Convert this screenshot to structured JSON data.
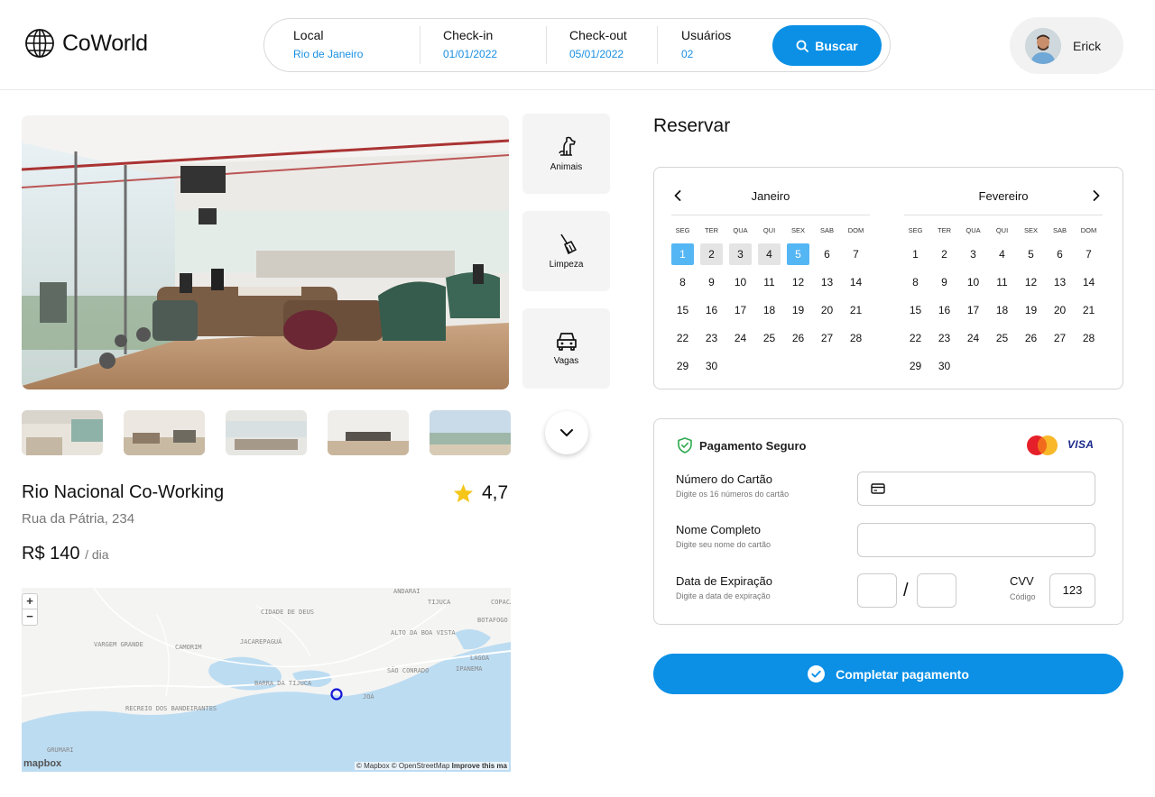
{
  "header": {
    "logo_text": "CoWorld",
    "search": {
      "fields": [
        {
          "label": "Local",
          "value": "Rio de Janeiro"
        },
        {
          "label": "Check-in",
          "value": "01/01/2022"
        },
        {
          "label": "Check-out",
          "value": "05/01/2022"
        },
        {
          "label": "Usuários",
          "value": "02"
        }
      ],
      "button_label": "Buscar"
    },
    "user": {
      "name": "Erick"
    }
  },
  "amenities": [
    {
      "label": "Animais",
      "icon": "dog-icon"
    },
    {
      "label": "Limpeza",
      "icon": "broom-icon"
    },
    {
      "label": "Vagas",
      "icon": "car-icon"
    }
  ],
  "place": {
    "name": "Rio Nacional Co-Working",
    "rating": "4,7",
    "address": "Rua da Pátria, 234",
    "price": "R$ 140",
    "price_unit": "/ dia"
  },
  "map": {
    "labels": [
      "ANDARAÍ",
      "CIDADE DE DEUS",
      "JACAREPAGUÁ",
      "ALTO DA BOA VISTA",
      "VARGEM GRANDE",
      "CAMORIM",
      "BARRA DA TIJUCA",
      "SÃO CONRADO",
      "BOTAFOGO",
      "IPANEMA",
      "RECREIO DOS BANDEIRANTES",
      "GRUMARI",
      "JOÁ",
      "TIJUCA",
      "COPACABANA",
      "LAGOA"
    ],
    "attribution": "© Mapbox © OpenStreetMap",
    "improve": "Improve this ma",
    "logo": "mapbox",
    "zoom_in": "+",
    "zoom_out": "−"
  },
  "reserve": {
    "title": "Reservar",
    "weekdays": [
      "SEG",
      "TER",
      "QUA",
      "QUI",
      "SEX",
      "SAB",
      "DOM"
    ],
    "months": [
      {
        "name": "Janeiro",
        "days": [
          "1",
          "2",
          "3",
          "4",
          "5",
          "6",
          "7",
          "8",
          "9",
          "10",
          "11",
          "12",
          "13",
          "14",
          "15",
          "16",
          "17",
          "18",
          "19",
          "20",
          "21",
          "22",
          "23",
          "24",
          "25",
          "26",
          "27",
          "28",
          "29",
          "30"
        ],
        "selected": [
          "1",
          "5"
        ],
        "in_range": [
          "2",
          "3",
          "4"
        ]
      },
      {
        "name": "Fevereiro",
        "days": [
          "1",
          "2",
          "3",
          "4",
          "5",
          "6",
          "7",
          "8",
          "9",
          "10",
          "11",
          "12",
          "13",
          "14",
          "15",
          "16",
          "17",
          "18",
          "19",
          "20",
          "21",
          "22",
          "23",
          "24",
          "25",
          "26",
          "27",
          "28",
          "29",
          "30"
        ],
        "selected": [],
        "in_range": []
      }
    ]
  },
  "payment": {
    "title": "Pagamento Seguro",
    "card_brand": "VISA",
    "card_number": {
      "label": "Número do Cartão",
      "hint": "Digite os 16 números do cartão"
    },
    "full_name": {
      "label": "Nome Completo",
      "hint": "Digite seu nome do cartão"
    },
    "expiry": {
      "label": "Data de Expiração",
      "hint": "Digite a data de expiração",
      "separator": "/"
    },
    "cvv": {
      "label": "CVV",
      "hint": "Código",
      "value": "123"
    },
    "submit_label": "Completar pagamento"
  },
  "colors": {
    "accent": "#0b90e6",
    "link": "#1a8fe3",
    "selected_day": "#55b6f4",
    "range_day": "#e4e4e4",
    "star": "#f5c518"
  }
}
